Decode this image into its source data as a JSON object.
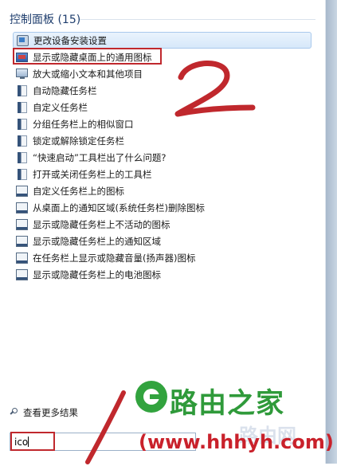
{
  "header": {
    "title": "控制面板 (15)"
  },
  "results": [
    {
      "label": "更改设备安装设置",
      "icon": "devices-icon",
      "selected": true,
      "highlighted": false
    },
    {
      "label": "显示或隐藏桌面上的通用图标",
      "icon": "display-icon",
      "selected": false,
      "highlighted": true
    },
    {
      "label": "放大或缩小文本和其他项目",
      "icon": "monitor-icon",
      "selected": false,
      "highlighted": false
    },
    {
      "label": "自动隐藏任务栏",
      "icon": "taskbar-v-icon",
      "selected": false,
      "highlighted": false
    },
    {
      "label": "自定义任务栏",
      "icon": "taskbar-v-icon",
      "selected": false,
      "highlighted": false
    },
    {
      "label": "分组任务栏上的相似窗口",
      "icon": "taskbar-v-icon",
      "selected": false,
      "highlighted": false
    },
    {
      "label": "锁定或解除锁定任务栏",
      "icon": "taskbar-v-icon",
      "selected": false,
      "highlighted": false
    },
    {
      "label": "“快速启动”工具栏出了什么问题?",
      "icon": "taskbar-v-icon",
      "selected": false,
      "highlighted": false
    },
    {
      "label": "打开或关闭任务栏上的工具栏",
      "icon": "taskbar-v-icon",
      "selected": false,
      "highlighted": false
    },
    {
      "label": "自定义任务栏上的图标",
      "icon": "taskbar-icon",
      "selected": false,
      "highlighted": false
    },
    {
      "label": "从桌面上的通知区域(系统任务栏)删除图标",
      "icon": "taskbar-icon",
      "selected": false,
      "highlighted": false
    },
    {
      "label": "显示或隐藏任务栏上不活动的图标",
      "icon": "taskbar-icon",
      "selected": false,
      "highlighted": false
    },
    {
      "label": "显示或隐藏任务栏上的通知区域",
      "icon": "taskbar-icon",
      "selected": false,
      "highlighted": false
    },
    {
      "label": "在任务栏上显示或隐藏音量(扬声器)图标",
      "icon": "taskbar-icon",
      "selected": false,
      "highlighted": false
    },
    {
      "label": "显示或隐藏任务栏上的电池图标",
      "icon": "taskbar-icon",
      "selected": false,
      "highlighted": false
    }
  ],
  "footer": {
    "see_more": "查看更多结果"
  },
  "search": {
    "value": "ico"
  },
  "annotations": {
    "step_two": "2",
    "step_one": "1"
  },
  "watermark": {
    "name": "路由之家",
    "url": "(www.hhhyh.com)",
    "faint": "路由网"
  },
  "colors": {
    "highlight": "#c0282d",
    "watermark_green": "#2f9a3a",
    "watermark_red": "#c9212b"
  }
}
